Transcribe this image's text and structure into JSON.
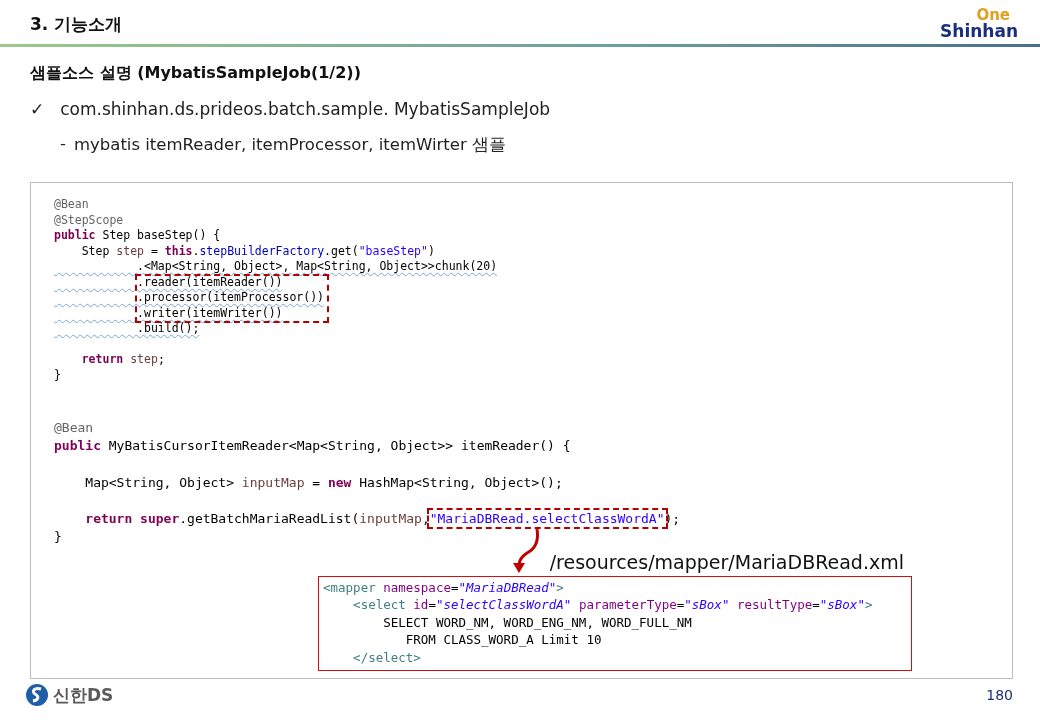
{
  "header": {
    "title": "3. 기능소개",
    "logo_top": "One",
    "logo_bottom": "Shinhan"
  },
  "subtitle": "샘플소스 설명 (MybatisSampleJob(1/2))",
  "bullets": [
    {
      "kind": "check",
      "mark": "✓",
      "text": "com.shinhan.ds.prideos.batch.sample. MybatisSampleJob"
    },
    {
      "kind": "dash",
      "mark": "-",
      "text": "mybatis itemReader, itemProcessor, itemWirter 샘플"
    }
  ],
  "code_panel": {
    "blocks": [
      {
        "lines": [
          {
            "tokens": [
              {
                "text": "@Bean",
                "kind": "annot"
              }
            ]
          },
          {
            "tokens": [
              {
                "text": "@StepScope",
                "kind": "annot"
              }
            ]
          },
          {
            "tokens": [
              {
                "text": "public",
                "kind": "kw"
              },
              {
                "text": " Step baseStep() {",
                "kind": "plain"
              }
            ]
          },
          {
            "tokens": [
              {
                "text": "    Step ",
                "kind": "plain"
              },
              {
                "text": "step",
                "kind": "var"
              },
              {
                "text": " = ",
                "kind": "plain"
              },
              {
                "text": "this",
                "kind": "kw"
              },
              {
                "text": ".",
                "kind": "plain"
              },
              {
                "text": "stepBuilderFactory",
                "kind": "field"
              },
              {
                "text": ".get(",
                "kind": "plain"
              },
              {
                "text": "\"baseStep\"",
                "kind": "str"
              },
              {
                "text": ")",
                "kind": "plain"
              }
            ]
          },
          {
            "squiggle": true,
            "tokens": [
              {
                "text": "            .<Map<String, Object>, Map<String, Object>>chunk(20)",
                "kind": "plain"
              }
            ]
          },
          {
            "squiggle": true,
            "boxed": true,
            "tokens": [
              {
                "text": "            .reader(itemReader())",
                "kind": "plain"
              }
            ]
          },
          {
            "squiggle": true,
            "boxed": true,
            "tokens": [
              {
                "text": "            .processor(itemProcessor())",
                "kind": "plain"
              }
            ]
          },
          {
            "squiggle": true,
            "boxed": true,
            "tokens": [
              {
                "text": "            .writer(itemWriter())",
                "kind": "plain"
              }
            ]
          },
          {
            "squiggle": true,
            "tokens": [
              {
                "text": "            .build();",
                "kind": "plain"
              }
            ]
          },
          {
            "gap_before": true,
            "tokens": [
              {
                "text": "    return ",
                "kind": "kw"
              },
              {
                "text": "step",
                "kind": "var"
              },
              {
                "text": ";",
                "kind": "plain"
              }
            ]
          },
          {
            "tokens": [
              {
                "text": "}",
                "kind": "plain"
              }
            ]
          }
        ]
      },
      {
        "lines": [
          {
            "tokens": [
              {
                "text": "@Bean",
                "kind": "annot"
              }
            ]
          },
          {
            "tokens": [
              {
                "text": "public",
                "kind": "kw"
              },
              {
                "text": " MyBatisCursorItemReader<Map<String, Object>> itemReader() {",
                "kind": "plain"
              }
            ]
          },
          {
            "gap_before": true,
            "tokens": [
              {
                "text": "    Map<String, Object> ",
                "kind": "plain"
              },
              {
                "text": "inputMap",
                "kind": "var"
              },
              {
                "text": " = ",
                "kind": "plain"
              },
              {
                "text": "new",
                "kind": "kw"
              },
              {
                "text": " HashMap<String, Object>();",
                "kind": "plain"
              }
            ]
          },
          {
            "gap_before": true,
            "tokens": [
              {
                "text": "    return super",
                "kind": "kw"
              },
              {
                "text": ".getBatchMariaReadList(",
                "kind": "plain"
              },
              {
                "text": "inputMap",
                "kind": "var"
              },
              {
                "text": ",",
                "kind": "plain"
              },
              {
                "text": "\"MariaDBRead.selectClassWordA\"",
                "kind": "str",
                "boxed": true
              },
              {
                "text": ");",
                "kind": "plain"
              }
            ]
          },
          {
            "tokens": [
              {
                "text": "}",
                "kind": "plain"
              }
            ]
          }
        ]
      }
    ],
    "mapper_path": "/resources/mapper/MariaDBRead.xml",
    "mapper_lines": [
      {
        "tokens": [
          {
            "text": "<mapper",
            "kind": "tag"
          },
          {
            "text": " namespace",
            "kind": "attr"
          },
          {
            "text": "=",
            "kind": "plain"
          },
          {
            "text": "\"MariaDBRead\"",
            "kind": "xstr"
          },
          {
            "text": ">",
            "kind": "tag"
          }
        ]
      },
      {
        "tokens": [
          {
            "text": "    <select",
            "kind": "tag"
          },
          {
            "text": " id",
            "kind": "attr"
          },
          {
            "text": "=",
            "kind": "plain"
          },
          {
            "text": "\"selectClassWordA\"",
            "kind": "xstr"
          },
          {
            "text": " parameterType",
            "kind": "attr"
          },
          {
            "text": "=",
            "kind": "plain"
          },
          {
            "text": "\"sBox\"",
            "kind": "xstr"
          },
          {
            "text": " resultType",
            "kind": "attr"
          },
          {
            "text": "=",
            "kind": "plain"
          },
          {
            "text": "\"sBox\"",
            "kind": "xstr"
          },
          {
            "text": ">",
            "kind": "tag"
          }
        ]
      },
      {
        "tokens": [
          {
            "text": "        SELECT WORD_NM, WORD_ENG_NM, WORD_FULL_NM",
            "kind": "plain"
          }
        ]
      },
      {
        "tokens": [
          {
            "text": "           FROM CLASS_WORD_A Limit 10",
            "kind": "plain"
          }
        ]
      },
      {
        "tokens": [
          {
            "text": "    </select>",
            "kind": "tag"
          }
        ]
      }
    ]
  },
  "footer": {
    "company": "신한DS",
    "page": "180"
  }
}
